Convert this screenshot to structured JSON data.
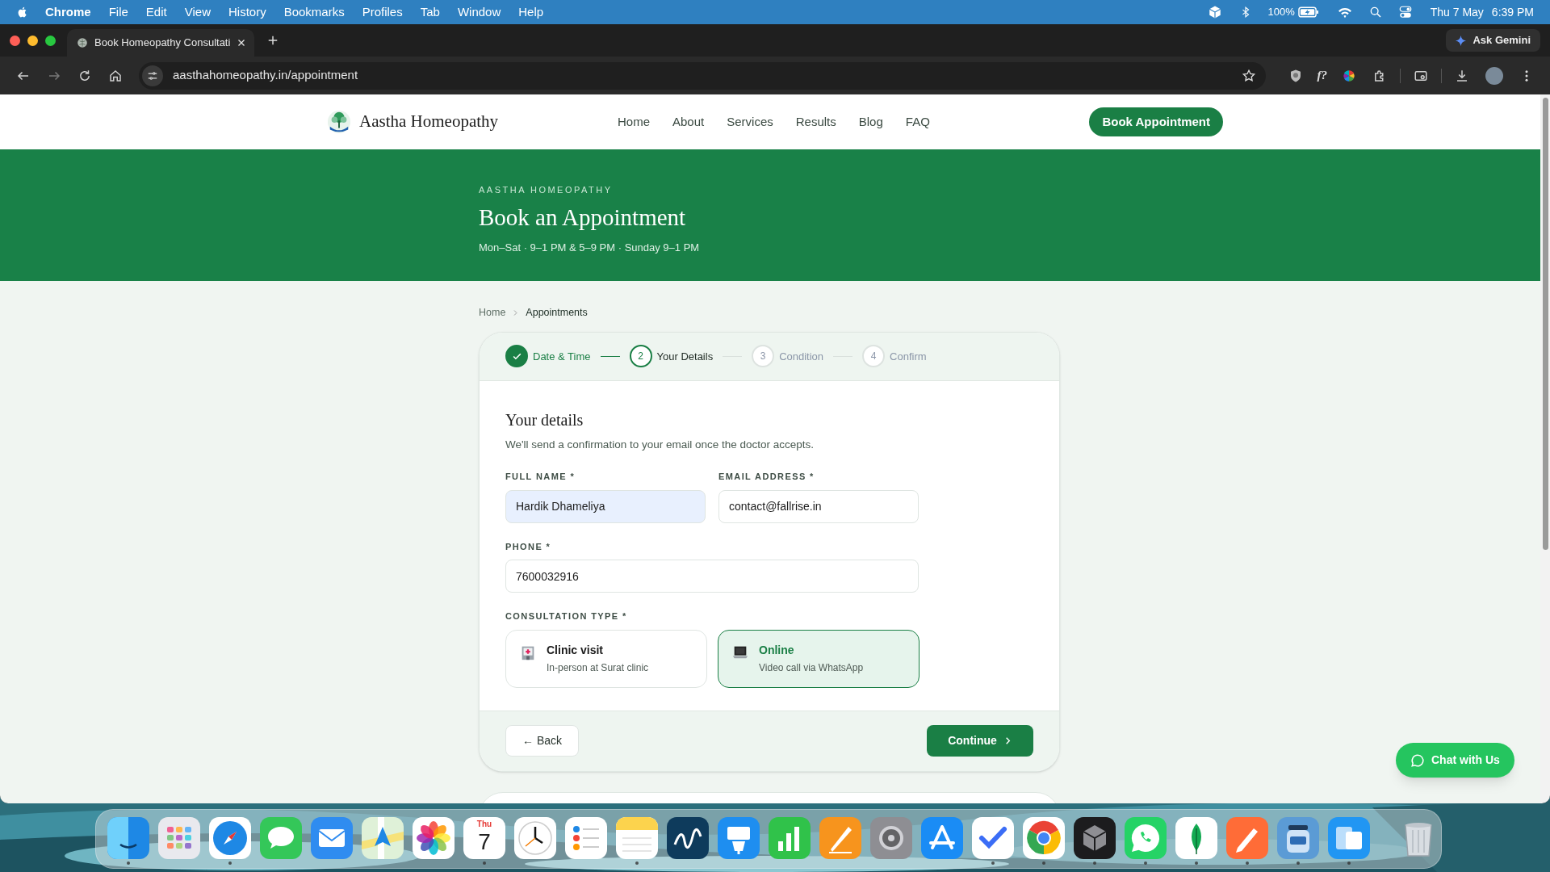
{
  "menu_bar": {
    "app_name": "Chrome",
    "menus": [
      "File",
      "Edit",
      "View",
      "History",
      "Bookmarks",
      "Profiles",
      "Tab",
      "Window",
      "Help"
    ],
    "battery": "100%",
    "date": "Thu 7 May",
    "time": "6:39 PM"
  },
  "browser": {
    "tab_title": "Book Homeopathy Consultati",
    "ask_gemini": "Ask Gemini",
    "url": "aasthahomeopathy.in/appointment",
    "extension_label": "f?"
  },
  "header": {
    "logo_text": "Aastha Homeopathy",
    "nav": [
      "Home",
      "About",
      "Services",
      "Results",
      "Blog",
      "FAQ"
    ],
    "cta": "Book Appointment"
  },
  "hero": {
    "eyebrow": "AASTHA HOMEOPATHY",
    "title": "Book an Appointment",
    "hours": "Mon–Sat · 9–1 PM & 5–9 PM · Sunday 9–1 PM"
  },
  "breadcrumb": [
    "Home",
    "Appointments"
  ],
  "steps": [
    {
      "label": "Date & Time",
      "done": true,
      "current": false
    },
    {
      "number": "2",
      "label": "Your Details",
      "done": false,
      "current": true
    },
    {
      "number": "3",
      "label": "Condition",
      "done": false,
      "current": false
    },
    {
      "number": "4",
      "label": "Confirm",
      "done": false,
      "current": false
    }
  ],
  "form": {
    "heading": "Your details",
    "subtitle": "We'll send a confirmation to your email once the doctor accepts.",
    "fields": [
      {
        "label": "FULL NAME *",
        "value": "Hardik Dhameliya",
        "autofilled": true
      },
      {
        "label": "EMAIL ADDRESS *",
        "value": "contact@fallrise.in",
        "autofilled": false
      },
      {
        "label": "PHONE *",
        "value": "7600032916",
        "autofilled": false
      }
    ],
    "consultation_label": "CONSULTATION TYPE *",
    "options": [
      {
        "kind": "clinic",
        "title": "Clinic visit",
        "subtitle": "In-person at Surat clinic",
        "selected": false
      },
      {
        "kind": "online",
        "title": "Online",
        "subtitle": "Video call via WhatsApp",
        "selected": true
      }
    ],
    "back": "← Back",
    "continue": "Continue"
  },
  "chat_button": "Chat with Us",
  "dock": [
    {
      "kind": "finder",
      "running": true
    },
    {
      "kind": "launchpad",
      "running": false
    },
    {
      "kind": "compass",
      "running": true
    },
    {
      "kind": "bubble",
      "running": false
    },
    {
      "kind": "envelope",
      "running": false
    },
    {
      "kind": "map",
      "running": false
    },
    {
      "kind": "flower",
      "running": false
    },
    {
      "kind": "calendar",
      "running": true,
      "weekday": "Thu",
      "day": "7"
    },
    {
      "kind": "clock",
      "running": false
    },
    {
      "kind": "checklist",
      "running": false
    },
    {
      "kind": "notepad",
      "running": true
    },
    {
      "kind": "squiggle",
      "running": false
    },
    {
      "kind": "podium",
      "running": false
    },
    {
      "kind": "bars",
      "running": false
    },
    {
      "kind": "pen",
      "running": false
    },
    {
      "kind": "gear",
      "running": false
    },
    {
      "kind": "triangle",
      "running": false
    },
    {
      "kind": "check",
      "running": true
    },
    {
      "kind": "tricolor",
      "running": true
    },
    {
      "kind": "cube",
      "running": true
    },
    {
      "kind": "phone",
      "running": true
    },
    {
      "kind": "leaf",
      "running": true
    },
    {
      "kind": "diagonal-pen",
      "running": true
    },
    {
      "kind": "jar",
      "running": true
    },
    {
      "kind": "windows",
      "running": true
    },
    {
      "kind": "trash",
      "running": false
    }
  ]
}
